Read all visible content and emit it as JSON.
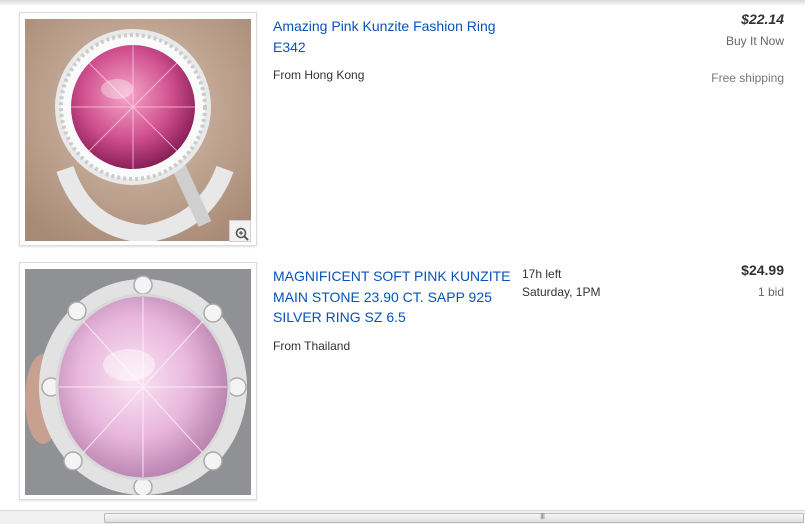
{
  "listings": [
    {
      "title": "Amazing Pink Kunzite Fashion Ring E342",
      "origin": "From Hong Kong",
      "price": "$22.14",
      "format": "Buy It Now",
      "shipping": "Free shipping",
      "time_left": "",
      "end_time": "",
      "image_icon": "pink-round-ring-photo",
      "zoom_icon": "magnifier-plus-icon"
    },
    {
      "title": "MAGNIFICENT SOFT PINK KUNZITE MAIN STONE 23.90 CT. SAPP 925 SILVER RING SZ 6.5",
      "origin": "From Thailand",
      "price": "$24.99",
      "format": "1 bid",
      "time_left": "17h left",
      "end_time": "Saturday, 1PM",
      "image_icon": "pink-oval-ring-photo"
    }
  ],
  "scrollbar": {
    "grip": "III"
  },
  "colors": {
    "link": "#0654ba",
    "text": "#333333",
    "muted": "#777777"
  }
}
